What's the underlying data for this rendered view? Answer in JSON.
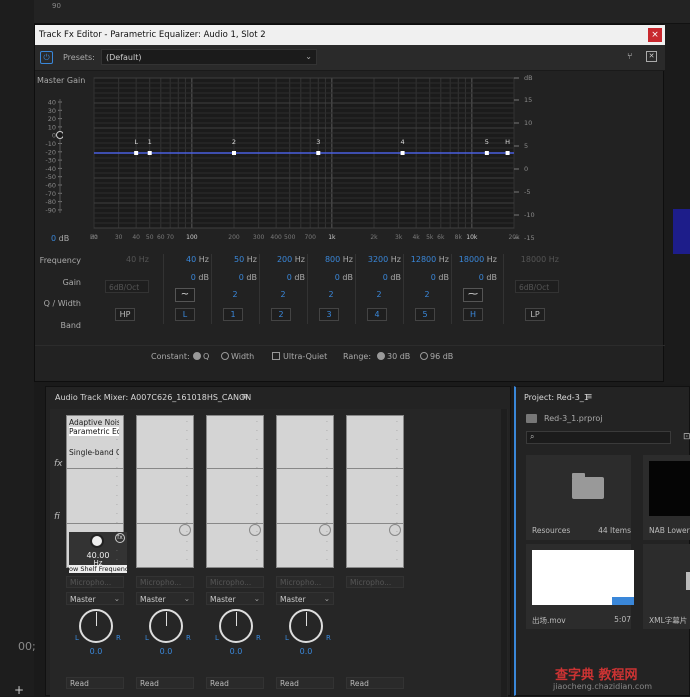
{
  "background": {
    "ruler_number": "90",
    "timecode": "00;",
    "plus_label": "+"
  },
  "fx_editor": {
    "title": "Track Fx Editor - Parametric Equalizer: Audio 1, Slot 2",
    "close_label": "×",
    "power_icon": "power-icon",
    "presets_label": "Presets:",
    "presets_value": "(Default)",
    "master_gain_label": "Master Gain",
    "master_gain_value": "0",
    "master_gain_unit": "dB",
    "left_scale": [
      "40",
      "30",
      "20",
      "10",
      "0",
      "-10",
      "-20",
      "-30",
      "-40",
      "-50",
      "-60",
      "-70",
      "-80",
      "-90"
    ],
    "right_scale": [
      "dB",
      "15",
      "10",
      "5",
      "0",
      "-5",
      "-10",
      "-15"
    ],
    "x_ticks": [
      "Hz",
      "20",
      "30",
      "40",
      "50",
      "60",
      "70",
      "100",
      "200",
      "300",
      "400",
      "500",
      "700",
      "1k",
      "2k",
      "3k",
      "4k",
      "5k",
      "6k",
      "8k",
      "10k",
      "20k"
    ],
    "nodes": [
      "L",
      "1",
      "2",
      "3",
      "4",
      "5",
      "H"
    ],
    "row_labels": {
      "frequency": "Frequency",
      "gain": "Gain",
      "q_width": "Q / Width",
      "band": "Band"
    },
    "hp": {
      "freq": "40",
      "unit": "Hz",
      "slope": "6dB/Oct",
      "band": "HP"
    },
    "lp": {
      "freq": "18000",
      "unit": "Hz",
      "slope": "6dB/Oct",
      "band": "LP"
    },
    "bands": [
      {
        "freq": "40",
        "unit": "Hz",
        "gain": "0",
        "gain_unit": "dB",
        "q": "",
        "band": "L",
        "shape": "~"
      },
      {
        "freq": "50",
        "unit": "Hz",
        "gain": "0",
        "gain_unit": "dB",
        "q": "2",
        "band": "1",
        "shape": ""
      },
      {
        "freq": "200",
        "unit": "Hz",
        "gain": "0",
        "gain_unit": "dB",
        "q": "2",
        "band": "2",
        "shape": ""
      },
      {
        "freq": "800",
        "unit": "Hz",
        "gain": "0",
        "gain_unit": "dB",
        "q": "2",
        "band": "3",
        "shape": ""
      },
      {
        "freq": "3200",
        "unit": "Hz",
        "gain": "0",
        "gain_unit": "dB",
        "q": "2",
        "band": "4",
        "shape": ""
      },
      {
        "freq": "12800",
        "unit": "Hz",
        "gain": "0",
        "gain_unit": "dB",
        "q": "2",
        "band": "5",
        "shape": ""
      },
      {
        "freq": "18000",
        "unit": "Hz",
        "gain": "0",
        "gain_unit": "dB",
        "q": "",
        "band": "H",
        "shape": "⁓"
      }
    ],
    "constant_label": "Constant:",
    "constant_q": "Q",
    "constant_width": "Width",
    "ultra_quiet": "Ultra-Quiet",
    "range_label": "Range:",
    "range_30": "30 dB",
    "range_96": "96 dB",
    "accent": "#3a87d9"
  },
  "mixer": {
    "tab": "Audio Track Mixer: A007C626_161018HS_CANON",
    "menu_icon": "≡",
    "fx_mark": "fx",
    "send_mark": "fi",
    "strip1_effects": [
      "Adaptive Noise",
      "Parametric Eq",
      "Single-band C"
    ],
    "knob": {
      "value": "40.00",
      "unit": "Hz",
      "name": "ow Shelf Frequency"
    },
    "fx_badge": "fx",
    "input_label": "Micropho...",
    "output_label": "Master",
    "pan_l": "L",
    "pan_r": "R",
    "pan_value": "0.0",
    "read_label": "Read",
    "chevron": "⌄"
  },
  "project": {
    "tab": "Project: Red-3_1",
    "menu_icon": "≡",
    "file": "Red-3_1.prproj",
    "search_icon": "search-icon",
    "tiles": [
      {
        "name": "Resources",
        "meta": "44 Items"
      },
      {
        "name": "NAB Lower",
        "meta": ""
      },
      {
        "name": "出场.mov",
        "meta": "5:07"
      },
      {
        "name": "XML字幕片",
        "meta": ""
      }
    ]
  },
  "watermark": {
    "line1": "查字典 教程网",
    "line2": "jiaocheng.chazidian.com"
  }
}
